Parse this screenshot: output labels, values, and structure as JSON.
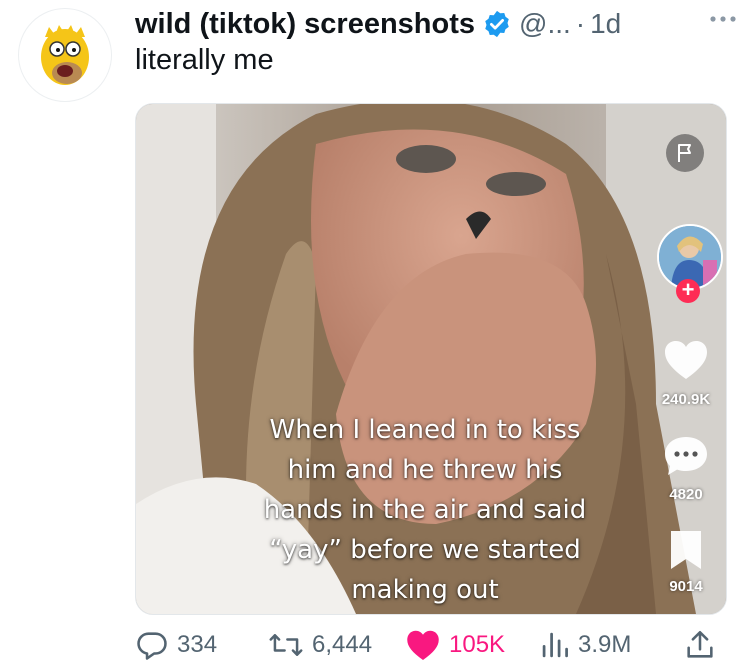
{
  "tweet": {
    "display_name": "wild (tiktok) screenshots",
    "handle": "@...",
    "separator": "·",
    "time": "1d",
    "text": "literally me",
    "avatar_icon": "cartoon-character-avatar",
    "verified_icon": "verified-badge-icon",
    "more_icon": "more-options-icon"
  },
  "media": {
    "caption_lines": [
      "When I leaned in to kiss",
      "him and he threw his",
      "hands in the air and said",
      "“yay” before we started",
      "making out"
    ],
    "likes": "240.9K",
    "comments": "4820",
    "saves": "9014",
    "icons": {
      "flag": "flag-icon",
      "follow": "follow-plus-icon",
      "like": "heart-icon",
      "comment": "comment-bubble-icon",
      "save": "bookmark-icon"
    }
  },
  "actions": {
    "replies": "334",
    "retweets": "6,444",
    "likes": "105K",
    "views": "3.9M",
    "icons": [
      "reply-icon",
      "retweet-icon",
      "like-icon",
      "views-icon",
      "share-icon"
    ]
  },
  "colors": {
    "text": "#0f1419",
    "secondary": "#536471",
    "verified": "#1d9bf0",
    "like": "#f91880",
    "tiktok_red": "#fe2c55"
  }
}
